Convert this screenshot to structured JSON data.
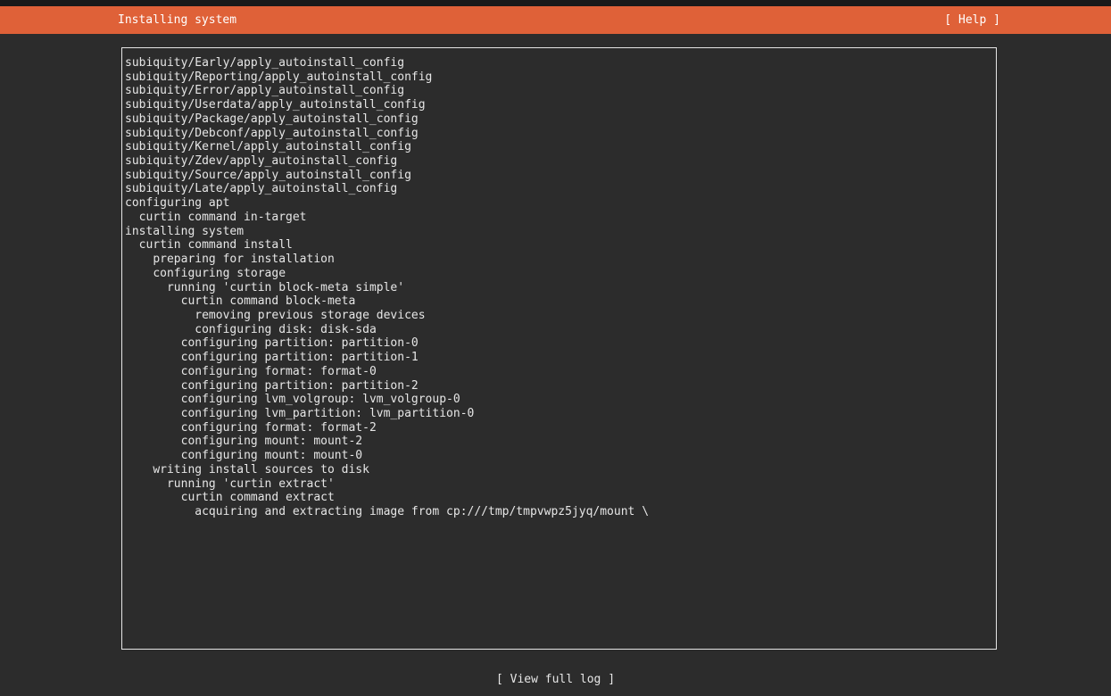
{
  "header": {
    "title": "Installing system",
    "help_label": "[ Help ]"
  },
  "log": {
    "lines": [
      {
        "indent": 0,
        "text": "subiquity/Early/apply_autoinstall_config"
      },
      {
        "indent": 0,
        "text": "subiquity/Reporting/apply_autoinstall_config"
      },
      {
        "indent": 0,
        "text": "subiquity/Error/apply_autoinstall_config"
      },
      {
        "indent": 0,
        "text": "subiquity/Userdata/apply_autoinstall_config"
      },
      {
        "indent": 0,
        "text": "subiquity/Package/apply_autoinstall_config"
      },
      {
        "indent": 0,
        "text": "subiquity/Debconf/apply_autoinstall_config"
      },
      {
        "indent": 0,
        "text": "subiquity/Kernel/apply_autoinstall_config"
      },
      {
        "indent": 0,
        "text": "subiquity/Zdev/apply_autoinstall_config"
      },
      {
        "indent": 0,
        "text": "subiquity/Source/apply_autoinstall_config"
      },
      {
        "indent": 0,
        "text": "subiquity/Late/apply_autoinstall_config"
      },
      {
        "indent": 0,
        "text": "configuring apt"
      },
      {
        "indent": 1,
        "text": "curtin command in-target"
      },
      {
        "indent": 0,
        "text": "installing system"
      },
      {
        "indent": 1,
        "text": "curtin command install"
      },
      {
        "indent": 2,
        "text": "preparing for installation"
      },
      {
        "indent": 2,
        "text": "configuring storage"
      },
      {
        "indent": 3,
        "text": "running 'curtin block-meta simple'"
      },
      {
        "indent": 4,
        "text": "curtin command block-meta"
      },
      {
        "indent": 5,
        "text": "removing previous storage devices"
      },
      {
        "indent": 5,
        "text": "configuring disk: disk-sda"
      },
      {
        "indent": 4,
        "text": "configuring partition: partition-0"
      },
      {
        "indent": 4,
        "text": "configuring partition: partition-1"
      },
      {
        "indent": 4,
        "text": "configuring format: format-0"
      },
      {
        "indent": 4,
        "text": "configuring partition: partition-2"
      },
      {
        "indent": 4,
        "text": "configuring lvm_volgroup: lvm_volgroup-0"
      },
      {
        "indent": 4,
        "text": "configuring lvm_partition: lvm_partition-0"
      },
      {
        "indent": 4,
        "text": "configuring format: format-2"
      },
      {
        "indent": 4,
        "text": "configuring mount: mount-2"
      },
      {
        "indent": 4,
        "text": "configuring mount: mount-0"
      },
      {
        "indent": 2,
        "text": "writing install sources to disk"
      },
      {
        "indent": 3,
        "text": "running 'curtin extract'"
      },
      {
        "indent": 4,
        "text": "curtin command extract"
      },
      {
        "indent": 5,
        "text": "acquiring and extracting image from cp:///tmp/tmpvwpz5jyq/mount \\"
      }
    ]
  },
  "footer": {
    "view_log_label": "[ View full log ]"
  },
  "colors": {
    "accent": "#df6138",
    "background": "#2c2c2c",
    "text": "#e6e6e6"
  }
}
